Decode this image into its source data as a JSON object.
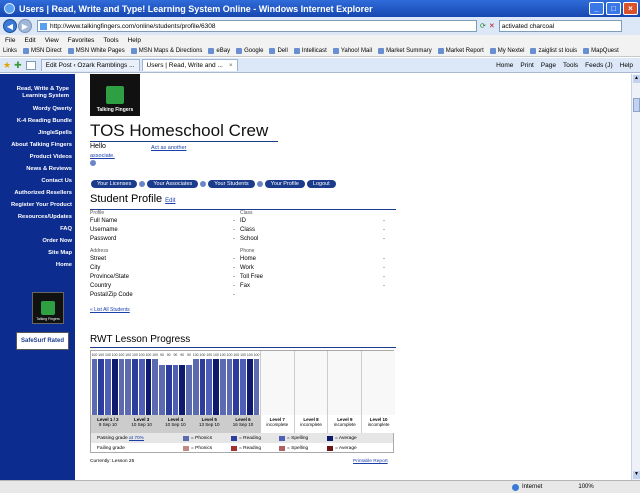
{
  "browser": {
    "title": "Users | Read, Write and Type! Learning System Online - Windows Internet Explorer",
    "url": "http://www.talkingfingers.com/online/students/profile/6308",
    "search_value": "activated charcoal",
    "menu": [
      "File",
      "Edit",
      "View",
      "Favorites",
      "Tools",
      "Help"
    ],
    "links_label": "Links",
    "links": [
      "MSN Direct",
      "MSN White Pages",
      "MSN Maps & Directions",
      "eBay",
      "Google",
      "Dell",
      "Intellicast",
      "Yahoo! Mail",
      "Market Summary",
      "Market Report",
      "My Nextel",
      "zaiglist st louis",
      "MapQuest"
    ],
    "tabs": [
      "Edit Post ‹ Ozark Ramblings ...",
      "Users | Read, Write and ..."
    ],
    "tools": [
      "Home",
      "Print",
      "Page",
      "Tools",
      "Feeds (J)",
      "Help"
    ],
    "status_zone": "Internet",
    "zoom": "100%"
  },
  "sidebar": {
    "items": [
      "Read, Write & Type Learning System",
      "Wordy Qwerty",
      "K-4 Reading Bundle",
      "JingleSpells",
      "About Talking Fingers",
      "Product Videos",
      "News & Reviews",
      "Contact Us",
      "Authorized Resellers",
      "Register Your Product",
      "Resources/Updates",
      "FAQ",
      "Order Now",
      "Site Map",
      "Home"
    ],
    "logo_text": "Talking Fingers",
    "safesurf_text": "SafeSurf Rated"
  },
  "main": {
    "logo_text": "Talking Fingers",
    "title": "TOS Homeschool Crew",
    "hello": "Hello",
    "act_as": "Act as another",
    "associate": "associate.",
    "nav": [
      "Your Licenses",
      "Your Associates",
      "Your Students",
      "Your Profile",
      "Logout"
    ],
    "profile_title": "Student Profile",
    "edit": "Edit",
    "profile_group": "Profile",
    "profile_fields": [
      "Full Name",
      "Username",
      "Password"
    ],
    "class_group": "Class",
    "class_fields": [
      "ID",
      "Class",
      "School"
    ],
    "address_group": "Address",
    "address_fields": [
      "Street",
      "City",
      "Province/State",
      "Country",
      "Postal/Zip Code"
    ],
    "phone_group": "Phone",
    "phone_fields": [
      "Home",
      "Work",
      "Toll Free",
      "Fax"
    ],
    "dash": "-",
    "list_students": "« List All Students",
    "rwt_title": "RWT Lesson Progress",
    "levels": [
      {
        "name": "Level 1 / 2",
        "date": "9 Sep 10",
        "scores": [
          "100",
          "100",
          "100",
          "100",
          "100"
        ]
      },
      {
        "name": "Level 3",
        "date": "10 Sep 10",
        "scores": [
          "100",
          "100",
          "100",
          "100",
          "100"
        ]
      },
      {
        "name": "Level 4",
        "date": "10 Sep 10",
        "scores": [
          "90",
          "90",
          "90",
          "90",
          "90"
        ]
      },
      {
        "name": "Level 5",
        "date": "13 Sep 10",
        "scores": [
          "100",
          "100",
          "100",
          "100",
          "100"
        ]
      },
      {
        "name": "Level 6",
        "date": "16 Sep 10",
        "scores": [
          "100",
          "100",
          "100",
          "100",
          "100"
        ]
      },
      {
        "name": "Level 7",
        "date": "incomplete"
      },
      {
        "name": "Level 8",
        "date": "incomplete"
      },
      {
        "name": "Level 9",
        "date": "incomplete"
      },
      {
        "name": "Level 10",
        "date": "incomplete"
      }
    ],
    "passing_label": "Passing grade",
    "passing_value": "at 70%",
    "failing_label": "Failing grade",
    "legend": [
      "= Phonics",
      "= Reading",
      "= Spelling",
      "= Average"
    ],
    "colors": {
      "pass": [
        "#5c6bb0",
        "#2d3d9c",
        "#4f5fb8",
        "#0d1a6e"
      ],
      "fail": [
        "#c08a88",
        "#a23030",
        "#b06060",
        "#6b1515"
      ]
    },
    "currently": "Currently: Lesson 25",
    "printable": "Printable Report"
  }
}
